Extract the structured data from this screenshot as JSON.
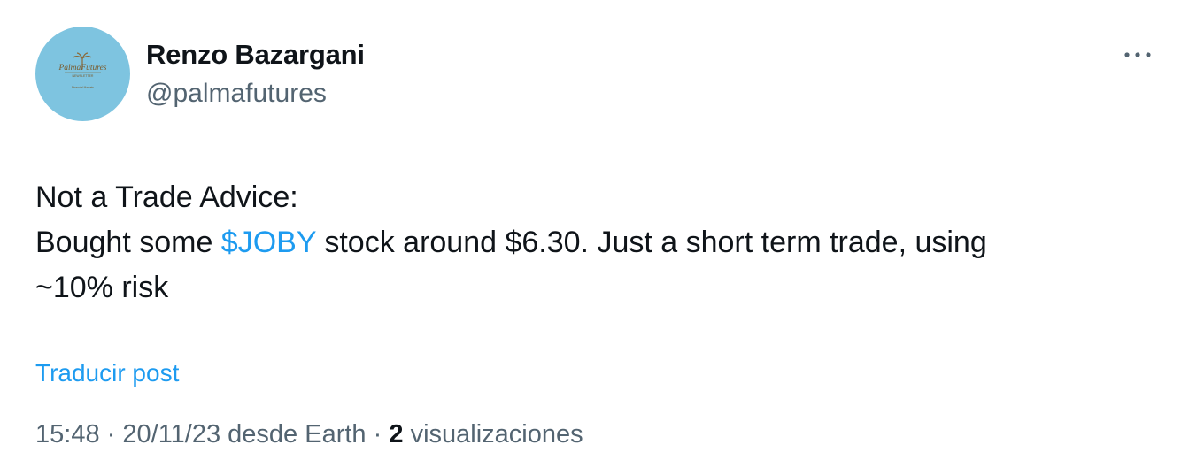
{
  "author": {
    "display_name": "Renzo Bazargani",
    "handle": "@palmafutures",
    "avatar": {
      "icon": "palm-tree-logo",
      "background": "#7ec4e0",
      "logo_text": "PalmaFutures",
      "logo_subtext": "NEWSLETTER",
      "logo_caption": "Financial Markets"
    }
  },
  "post": {
    "line1": "Not a Trade Advice:",
    "line2_prefix": "Bought some ",
    "cashtag": "$JOBY",
    "line2_suffix": " stock around $6.30. Just a short term trade, using",
    "line3": "~10% risk"
  },
  "translate_label": "Traducir post",
  "meta": {
    "time": "15:48",
    "separator": "·",
    "date_source": "20/11/23 desde Earth",
    "views_count": "2",
    "views_label": "visualizaciones"
  },
  "more_icon": "ellipsis-icon",
  "colors": {
    "accent": "#1d9bf0",
    "secondary_text": "#536471",
    "primary_text": "#0f1419"
  }
}
